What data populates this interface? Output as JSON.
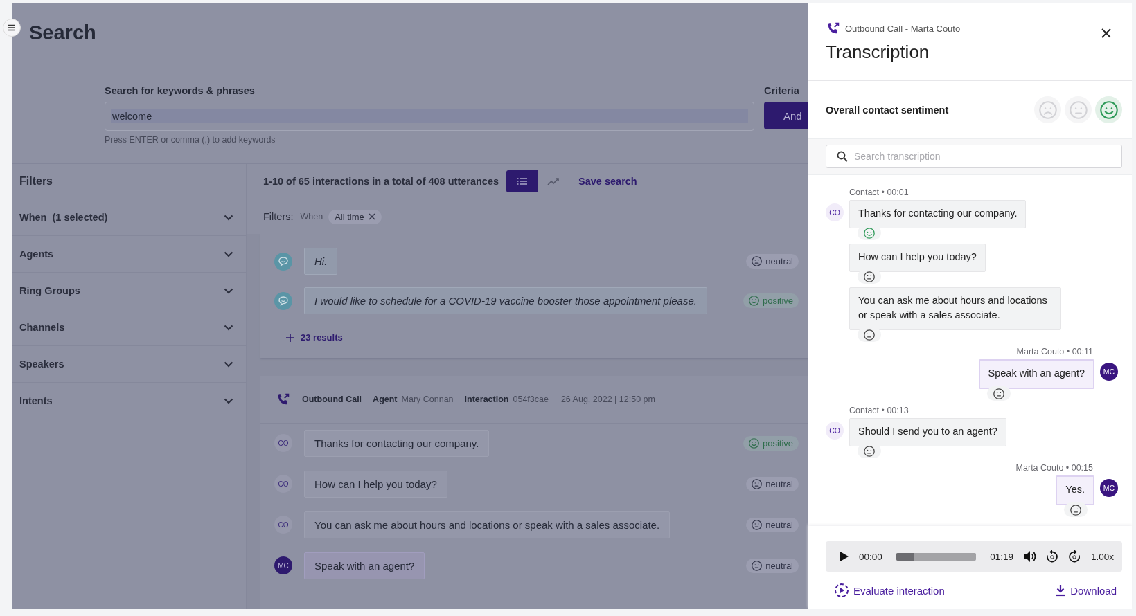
{
  "page": {
    "title": "Search"
  },
  "search": {
    "label": "Search for keywords & phrases",
    "value": "welcome",
    "hint": "Press ENTER or comma (,) to add keywords"
  },
  "criteria": {
    "label": "Criteria",
    "button": "And"
  },
  "filters": {
    "title": "Filters",
    "items": [
      {
        "label": "When",
        "count": "(1 selected)"
      },
      {
        "label": "Agents"
      },
      {
        "label": "Ring Groups"
      },
      {
        "label": "Channels"
      },
      {
        "label": "Speakers"
      },
      {
        "label": "Intents"
      }
    ]
  },
  "results": {
    "summary": "1-10 of 65 interactions in a total of 408 utterances",
    "views": [
      {
        "kind": "list",
        "selected": true
      },
      {
        "kind": "trend",
        "selected": false
      }
    ],
    "save": "Save search",
    "active_filters": {
      "label": "Filters:",
      "items": [
        {
          "field": "When",
          "value": "All time"
        }
      ]
    }
  },
  "cards": [
    {
      "utterances": [
        {
          "speaker": {
            "kind": "bot"
          },
          "text": "Hi.",
          "sentiment": {
            "kind": "neutral",
            "label": "neutral"
          }
        },
        {
          "speaker": {
            "kind": "bot"
          },
          "text": "I would like to schedule for a COVID-19 vaccine booster those appointment please.",
          "sentiment": {
            "kind": "positive",
            "label": "positive"
          }
        }
      ],
      "more": "23 results"
    },
    {
      "header": {
        "call_type": "Outbound Call",
        "agent_label": "Agent",
        "agent": "Mary Connan",
        "interaction_label": "Interaction",
        "interaction": "054f3cae",
        "date": "26 Aug, 2022 | 12:50 pm"
      },
      "utterances": [
        {
          "speaker": {
            "kind": "contact",
            "initials": "CO"
          },
          "text": "Thanks for contacting our company.",
          "sentiment": {
            "kind": "positive",
            "label": "positive"
          }
        },
        {
          "speaker": {
            "kind": "contact",
            "initials": "CO"
          },
          "text": "How can I help you today?",
          "sentiment": {
            "kind": "neutral",
            "label": "neutral"
          }
        },
        {
          "speaker": {
            "kind": "contact",
            "initials": "CO"
          },
          "text": "You can ask me about hours and locations or speak with a sales associate.",
          "sentiment": {
            "kind": "neutral",
            "label": "neutral"
          }
        },
        {
          "speaker": {
            "kind": "agent",
            "initials": "MC"
          },
          "text": "Speak with an agent?",
          "sentiment": {
            "kind": "neutral",
            "label": "neutral"
          }
        }
      ]
    }
  ],
  "panel": {
    "subtitle": "Outbound Call - Marta Couto",
    "title": "Transcription",
    "overall": {
      "label": "Overall contact sentiment",
      "options": [
        {
          "kind": "negative",
          "selected": false
        },
        {
          "kind": "neutral",
          "selected": false
        },
        {
          "kind": "positive",
          "selected": true
        }
      ]
    },
    "search_placeholder": "Search transcription",
    "messages": [
      {
        "kind": "contact",
        "meta": "Contact • 00:01",
        "initials": "CO",
        "text": "Thanks for contacting our company.",
        "sentiment": {
          "kind": "positive"
        }
      },
      {
        "kind": "contact",
        "text": "How can I help you today?",
        "sentiment": {
          "kind": "neutral"
        }
      },
      {
        "kind": "contact",
        "text": "You can ask me about hours and locations or speak with a sales associate.",
        "sentiment": {
          "kind": "neutral"
        }
      },
      {
        "kind": "agent",
        "meta": "Marta Couto • 00:11",
        "initials": "MC",
        "text": "Speak with an agent?",
        "sentiment": {
          "kind": "neutral"
        }
      },
      {
        "kind": "contact",
        "meta": "Contact • 00:13",
        "initials": "CO",
        "text": "Should I send you to an agent?",
        "sentiment": {
          "kind": "neutral"
        }
      },
      {
        "kind": "agent",
        "meta": "Marta Couto • 00:15",
        "initials": "MC",
        "text": "Yes.",
        "sentiment": {
          "kind": "neutral"
        }
      }
    ],
    "player": {
      "elapsed": "00:00",
      "level": 0.23,
      "total": "01:19",
      "speed": "1.00x"
    },
    "actions": {
      "evaluate": "Evaluate interaction",
      "download": "Download"
    }
  }
}
